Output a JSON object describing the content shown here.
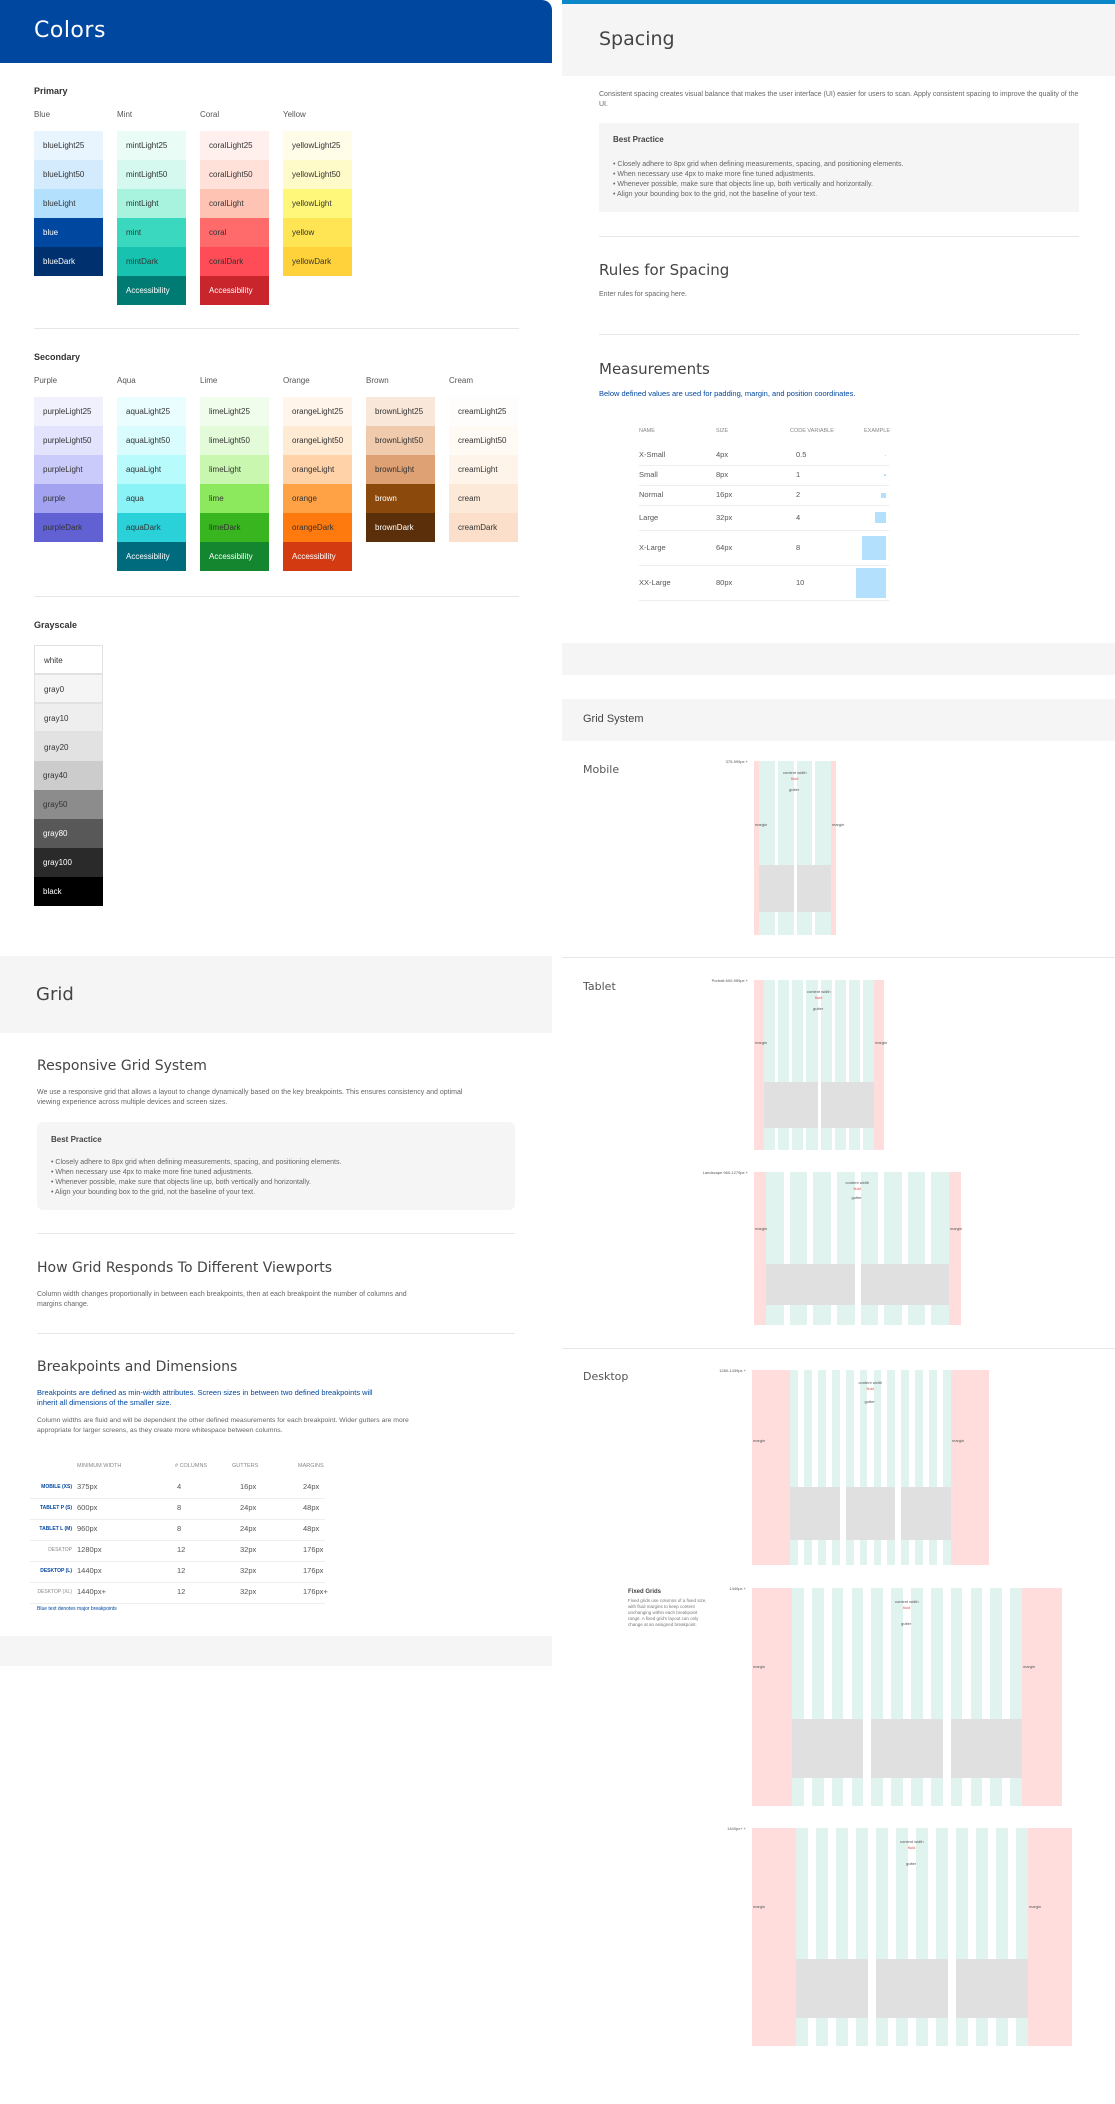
{
  "colors": {
    "title": "Colors",
    "primary_title": "Primary",
    "secondary_title": "Secondary",
    "grayscale_title": "Grayscale",
    "primary": [
      {
        "name": "Blue",
        "swatches": [
          [
            "blueLight25",
            "#e8f4fe"
          ],
          [
            "blueLight50",
            "#d3ebfd"
          ],
          [
            "blueLight",
            "#b3e0fd"
          ],
          [
            "blue",
            "#0047a0"
          ],
          [
            "blueDark",
            "#00306e"
          ]
        ]
      },
      {
        "name": "Mint",
        "swatches": [
          [
            "mintLight25",
            "#eafcf6"
          ],
          [
            "mintLight50",
            "#d5f9ee"
          ],
          [
            "mintLight",
            "#a7f3de"
          ],
          [
            "mint",
            "#3ad9bf"
          ],
          [
            "mintDark",
            "#17c3b0"
          ],
          [
            "Accessibility",
            "#007b73"
          ]
        ]
      },
      {
        "name": "Coral",
        "swatches": [
          [
            "coralLight25",
            "#fff0ed"
          ],
          [
            "coralLight50",
            "#ffe1da"
          ],
          [
            "coralLight",
            "#ffc3b3"
          ],
          [
            "coral",
            "#ff6b6b"
          ],
          [
            "coralDark",
            "#ff4c56"
          ],
          [
            "Accessibility",
            "#c9252c"
          ]
        ]
      },
      {
        "name": "Yellow",
        "swatches": [
          [
            "yellowLight25",
            "#fffde8"
          ],
          [
            "yellowLight50",
            "#fffbc8"
          ],
          [
            "yellowLight",
            "#fff77a"
          ],
          [
            "yellow",
            "#ffe553"
          ],
          [
            "yellowDark",
            "#ffd23c"
          ]
        ]
      }
    ],
    "secondary": [
      {
        "name": "Purple",
        "swatches": [
          [
            "purpleLight25",
            "#f1f1fe"
          ],
          [
            "purpleLight50",
            "#e3e3fd"
          ],
          [
            "purpleLight",
            "#cbcbfb"
          ],
          [
            "purple",
            "#a2a2f0"
          ],
          [
            "purpleDark",
            "#6161d4"
          ]
        ]
      },
      {
        "name": "Aqua",
        "swatches": [
          [
            "aquaLight25",
            "#ebfeff"
          ],
          [
            "aquaLight50",
            "#d9fdfe"
          ],
          [
            "aquaLight",
            "#b7fbfd"
          ],
          [
            "aqua",
            "#8af3f7"
          ],
          [
            "aquaDark",
            "#2bd1d9"
          ],
          [
            "Accessibility",
            "#006b7d"
          ]
        ]
      },
      {
        "name": "Lime",
        "swatches": [
          [
            "limeLight25",
            "#f1fdec"
          ],
          [
            "limeLight50",
            "#e3fbd9"
          ],
          [
            "limeLight",
            "#c9f7b0"
          ],
          [
            "lime",
            "#8ce85d"
          ],
          [
            "limeDark",
            "#38b51f"
          ],
          [
            "Accessibility",
            "#148630"
          ]
        ]
      },
      {
        "name": "Orange",
        "swatches": [
          [
            "orangeLight25",
            "#fff5ea"
          ],
          [
            "orangeLight50",
            "#ffead4"
          ],
          [
            "orangeLight",
            "#ffd2a8"
          ],
          [
            "orange",
            "#ffa245"
          ],
          [
            "orangeDark",
            "#ff7a0e"
          ],
          [
            "Accessibility",
            "#d33a12"
          ]
        ]
      },
      {
        "name": "Brown",
        "swatches": [
          [
            "brownLight25",
            "#f9e8da"
          ],
          [
            "brownLight50",
            "#efcaad"
          ],
          [
            "brownLight",
            "#dea173"
          ],
          [
            "brown",
            "#8b4a0c"
          ],
          [
            "brownDark",
            "#5a2f0a"
          ]
        ]
      },
      {
        "name": "Cream",
        "swatches": [
          [
            "creamLight25",
            "#fffdfb"
          ],
          [
            "creamLight50",
            "#fffaf4"
          ],
          [
            "creamLight",
            "#fff4ea"
          ],
          [
            "cream",
            "#fde9d8"
          ],
          [
            "creamDark",
            "#fbdfca"
          ]
        ]
      }
    ],
    "grayscale": [
      [
        "white",
        "#ffffff"
      ],
      [
        "gray0",
        "#f5f5f5"
      ],
      [
        "gray10",
        "#eeeeee"
      ],
      [
        "gray20",
        "#e2e2e2"
      ],
      [
        "gray40",
        "#cccccc"
      ],
      [
        "gray50",
        "#8c8c8c"
      ],
      [
        "gray80",
        "#585858"
      ],
      [
        "gray100",
        "#2a2a2a"
      ],
      [
        "black",
        "#000000"
      ]
    ]
  },
  "spacing": {
    "title": "Spacing",
    "intro": "Consistent spacing creates visual balance that makes the user interface (UI) easier for users to scan. Apply consistent spacing to improve the quality of the UI.",
    "bp_title": "Best Practice",
    "bp_items": [
      "• Closely adhere to 8px grid when defining measurements, spacing, and positioning elements.",
      "• When necessary use 4px to make more fine tuned adjustments.",
      "• Whenever possible, make sure that objects line up, both vertically and horizontally.",
      "• Align your bounding box to the grid, not the baseline of your text."
    ],
    "rules_title": "Rules for Spacing",
    "rules_text": "Enter rules for spacing here.",
    "meas_title": "Measurements",
    "meas_sub": "Below defined values are used for padding, margin, and position coordinates.",
    "table_headers": [
      "NAME",
      "SIZE",
      "CODE VARIABLE",
      "EXAMPLE"
    ],
    "table_rows": [
      [
        "X-Small",
        "4px",
        "0.5"
      ],
      [
        "Small",
        "8px",
        "1"
      ],
      [
        "Normal",
        "16px",
        "2"
      ],
      [
        "Large",
        "32px",
        "4"
      ],
      [
        "X-Large",
        "64px",
        "8"
      ],
      [
        "XX-Large",
        "80px",
        "10"
      ]
    ]
  },
  "grid_system": {
    "title": "Grid System",
    "mobile": "Mobile",
    "tablet": "Tablet",
    "desktop": "Desktop",
    "mobile_label": "375-599px +",
    "tablet_p_label": "Portrait 600-959px +",
    "tablet_l_label": "Landscape 960-1279px +",
    "desktop_label": "1280-1439px +",
    "desktop2_label": "1440px +",
    "desktop3_label": "1440px+ +",
    "content_width": "content width",
    "fluid": "fluid",
    "gutter": "gutter",
    "margin": "margin",
    "fixed_title": "Fixed Grids",
    "fixed_text": "Fixed grids use columns of a fixed size, with fluid margins to keep content unchanging within each breakpoint range. A fixed grid's layout can only change at an assigned breakpoint."
  },
  "grid": {
    "title": "Grid",
    "resp_title": "Responsive Grid System",
    "resp_text": "We use a responsive grid that allows a layout to change dynamically based on the key breakpoints. This ensures consistency and optimal viewing experience across multiple devices and screen sizes.",
    "bp_title": "Best Practice",
    "bp_items": [
      "• Closely adhere to 8px grid when defining measurements, spacing, and positioning elements.",
      "• When necessary use 4px to make more fine tuned adjustments.",
      "• Whenever possible, make sure that objects line up, both vertically and horizontally.",
      "• Align your bounding box to the grid, not the baseline of your text."
    ],
    "how_title": "How Grid Responds To Different Viewports",
    "how_text": "Column width changes proportionally in between each breakpoints, then at each breakpoint the number of columns and margins change.",
    "bd_title": "Breakpoints and Dimensions",
    "bd_blue": "Breakpoints are defined as min-width attributes. Screen sizes in between two defined breakpoints will inherit all dimensions of the smaller size.",
    "bd_text": "Column widths are fluid and will be dependent the other defined measurements for each breakpoint. Wider gutters are more appropriate for larger screens, as they create more whitespace between columns.",
    "table_headers": [
      "MINIMUM WIDTH",
      "# COLUMNS",
      "GUTTERS",
      "MARGINS"
    ],
    "table_rows": [
      [
        "MOBILE (XS)",
        "375px",
        "4",
        "16px",
        "24px"
      ],
      [
        "TABLET P (S)",
        "600px",
        "8",
        "24px",
        "48px"
      ],
      [
        "TABLET L (M)",
        "960px",
        "8",
        "24px",
        "48px"
      ],
      [
        "DESKTOP",
        "1280px",
        "12",
        "32px",
        "176px"
      ],
      [
        "DESKTOP (L)",
        "1440px",
        "12",
        "32px",
        "176px"
      ],
      [
        "DESKTOP (XL)",
        "1440px+",
        "12",
        "32px",
        "176px+"
      ]
    ],
    "footnote": "Blue text denotes major breakpoints"
  }
}
